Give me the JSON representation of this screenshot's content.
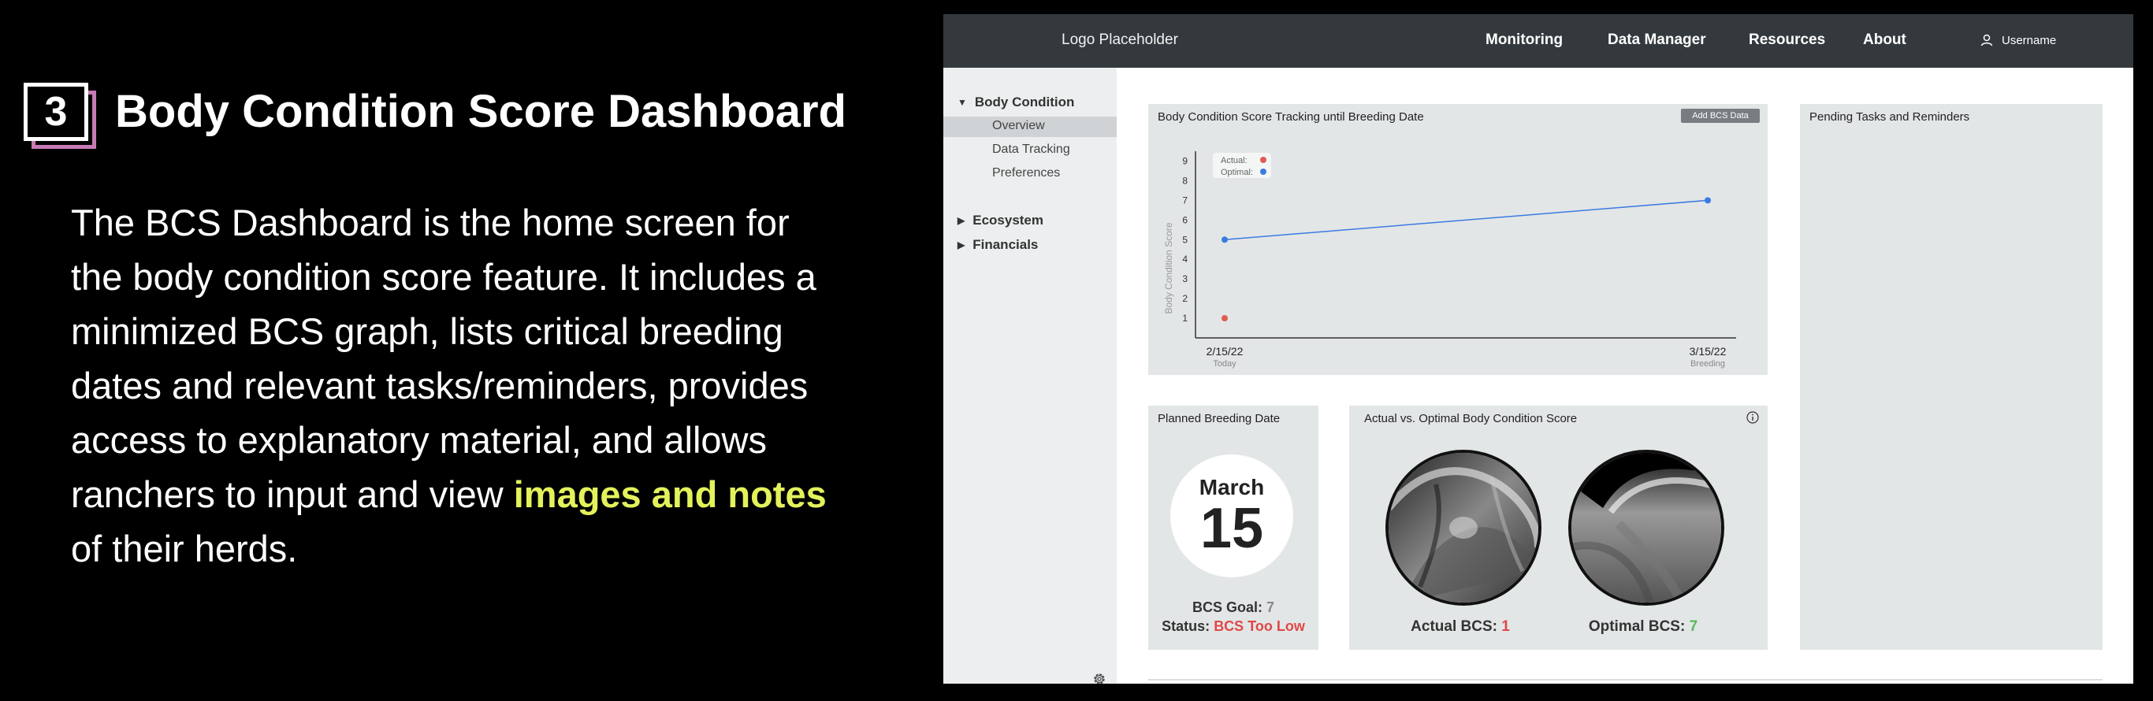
{
  "slide": {
    "number": "3",
    "title": "Body Condition Score Dashboard",
    "body_text": "The BCS Dashboard is the home screen for the body condition score feature. It includes a minimized BCS graph, lists critical breeding dates and relevant tasks/reminders, provides access to explanatory material, and allows ranchers to input and view",
    "highlight_text": "images and notes",
    "body_end": " of their herds.",
    "highlight_color": "#e3f25b",
    "badge_accent": "#c77bb5"
  },
  "app": {
    "logo": "Logo Placeholder",
    "nav": [
      "Monitoring",
      "Data Manager",
      "Resources",
      "About"
    ],
    "username": "Username",
    "user_icon": "user-icon"
  },
  "sidebar": {
    "groups": [
      {
        "label": "Body Condition",
        "expanded": true,
        "items": [
          "Overview",
          "Data Tracking",
          "Preferences"
        ],
        "active_item": "Overview"
      },
      {
        "label": "Ecosystem",
        "expanded": false
      },
      {
        "label": "Financials",
        "expanded": false
      }
    ],
    "settings_icon": "gear-icon"
  },
  "tracking_card": {
    "title": "Body Condition Score Tracking until Breeding Date",
    "add_button": "Add BCS Data"
  },
  "chart_data": {
    "type": "line",
    "ylabel": "Body Condition Score",
    "ylim": [
      0,
      9.5
    ],
    "yticks": [
      1,
      2,
      3,
      4,
      5,
      6,
      7,
      8,
      9
    ],
    "x_labels": [
      {
        "date": "2/15/22",
        "sub": "Today"
      },
      {
        "date": "3/15/22",
        "sub": "Breeding"
      }
    ],
    "legend": [
      {
        "name": "Actual:",
        "color": "#e15b4f"
      },
      {
        "name": "Optimal:",
        "color": "#3a7be0"
      }
    ],
    "series": [
      {
        "name": "Actual:",
        "color": "#e15b4f",
        "points": [
          {
            "x": "2/15/22",
            "y": 1
          }
        ]
      },
      {
        "name": "Optimal:",
        "color": "#3a7be0",
        "points": [
          {
            "x": "2/15/22",
            "y": 5
          },
          {
            "x": "3/15/22",
            "y": 7
          }
        ]
      }
    ],
    "grid": false,
    "legend_position": "top-left"
  },
  "breeding_card": {
    "title": "Planned Breeding Date",
    "month": "March",
    "day": "15",
    "goal_label": "BCS Goal:",
    "goal_value": "7",
    "status_label": "Status:",
    "status_value": "BCS Too Low"
  },
  "compare_card": {
    "title": "Actual vs. Optimal Body Condition Score",
    "info_icon": "info-icon",
    "actual_label": "Actual BCS:",
    "actual_value": "1",
    "optimal_label": "Optimal BCS:",
    "optimal_value": "7"
  },
  "tasks_card": {
    "title": "Pending Tasks and Reminders"
  }
}
